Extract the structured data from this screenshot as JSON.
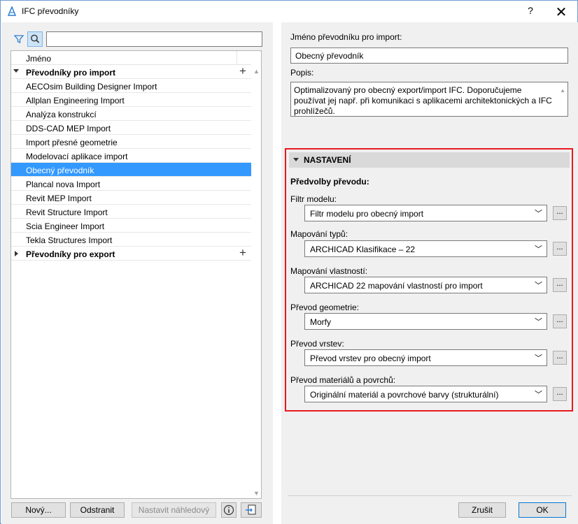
{
  "window": {
    "title": "IFC převodníky",
    "help_label": "?",
    "close_label": "✕"
  },
  "left": {
    "filter_icon": "filter-icon",
    "search_icon": "search-icon",
    "search_value": "",
    "column_header": "Jméno",
    "groups": [
      {
        "label": "Převodníky pro import",
        "expanded": true,
        "items": [
          "AECOsim Building Designer Import",
          "Allplan Engineering Import",
          "Analýza konstrukcí",
          "DDS-CAD MEP Import",
          "Import přesné geometrie",
          "Modelovací aplikace import",
          "Obecný převodník",
          "Plancal nova Import",
          "Revit MEP Import",
          "Revit Structure Import",
          "Scia Engineer Import",
          "Tekla Structures Import"
        ],
        "selected_index": 6
      },
      {
        "label": "Převodníky pro export",
        "expanded": false
      }
    ],
    "plus_label": "+",
    "buttons": {
      "new": "Nový...",
      "delete": "Odstranit",
      "preview": "Nastavit náhledový",
      "info": "i",
      "import": "⇥"
    }
  },
  "right": {
    "name_label": "Jméno převodníku pro import:",
    "name_value": "Obecný převodník",
    "desc_label": "Popis:",
    "desc_value": "Optimalizovaný pro obecný export/import IFC. Doporučujeme používat jej např. při komunikaci s aplikacemi architektonických a IFC prohlížečů.",
    "section_title": "NASTAVENÍ",
    "presets_label": "Předvolby převodu:",
    "fields": [
      {
        "label": "Filtr modelu:",
        "value": "Filtr modelu pro obecný import"
      },
      {
        "label": "Mapování typů:",
        "value": "ARCHICAD Klasifikace – 22"
      },
      {
        "label": "Mapování vlastností:",
        "value": "ARCHICAD 22 mapování vlastností pro import"
      },
      {
        "label": "Převod geometrie:",
        "value": "Morfy"
      },
      {
        "label": "Převod vrstev:",
        "value": "Převod vrstev pro obecný import"
      },
      {
        "label": "Převod materiálů a povrchů:",
        "value": "Originální materiál a povrchové barvy (strukturální)"
      }
    ],
    "dots_label": "...",
    "cancel_label": "Zrušit",
    "ok_label": "OK"
  },
  "colors": {
    "selection": "#3399ff",
    "highlight_box": "#e8191e",
    "primary_border": "#0078d7"
  }
}
